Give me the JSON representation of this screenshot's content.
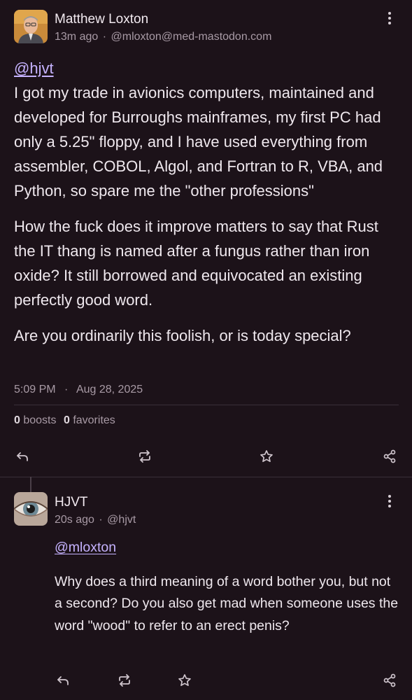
{
  "post": {
    "author_name": "Matthew Loxton",
    "time_ago": "13m ago",
    "separator": "·",
    "handle": "@mloxton@med-mastodon.com",
    "mention": "@hjvt",
    "paragraph1": "I got my trade in avionics computers, maintained and developed for Burroughs mainframes, my first PC had only a 5.25\" floppy, and I have used everything from assembler, COBOL, Algol, and Fortran to R, VBA, and Python, so spare me the \"other professions\"",
    "paragraph2": "How the fuck does it improve matters to say that Rust the IT thang is named after a fungus rather than iron oxide? It still borrowed and equivocated an existing perfectly good word.",
    "paragraph3": "Are you ordinarily this foolish, or is today special?",
    "timestamp_time": "5:09 PM",
    "timestamp_dot": "·",
    "timestamp_date": "Aug 28, 2025",
    "boosts_count": "0",
    "boosts_label": "boosts",
    "favorites_count": "0",
    "favorites_label": "favorites"
  },
  "reply": {
    "author_name": "HJVT",
    "time_ago": "20s ago",
    "separator": "·",
    "handle": "@hjvt",
    "mention": "@mloxton",
    "paragraph1": "Why does a third meaning of a word bother you, but not a second? Do you also get mad when someone uses the word \"wood\" to refer to an erect penis?"
  },
  "icons": {
    "reply": "reply-icon",
    "boost": "boost-icon",
    "favorite": "star-icon",
    "share": "share-icon",
    "more": "more-vertical-icon"
  },
  "colors": {
    "background": "#1c1219",
    "link": "#c6b3ff",
    "muted_text": "#a89aa5"
  }
}
